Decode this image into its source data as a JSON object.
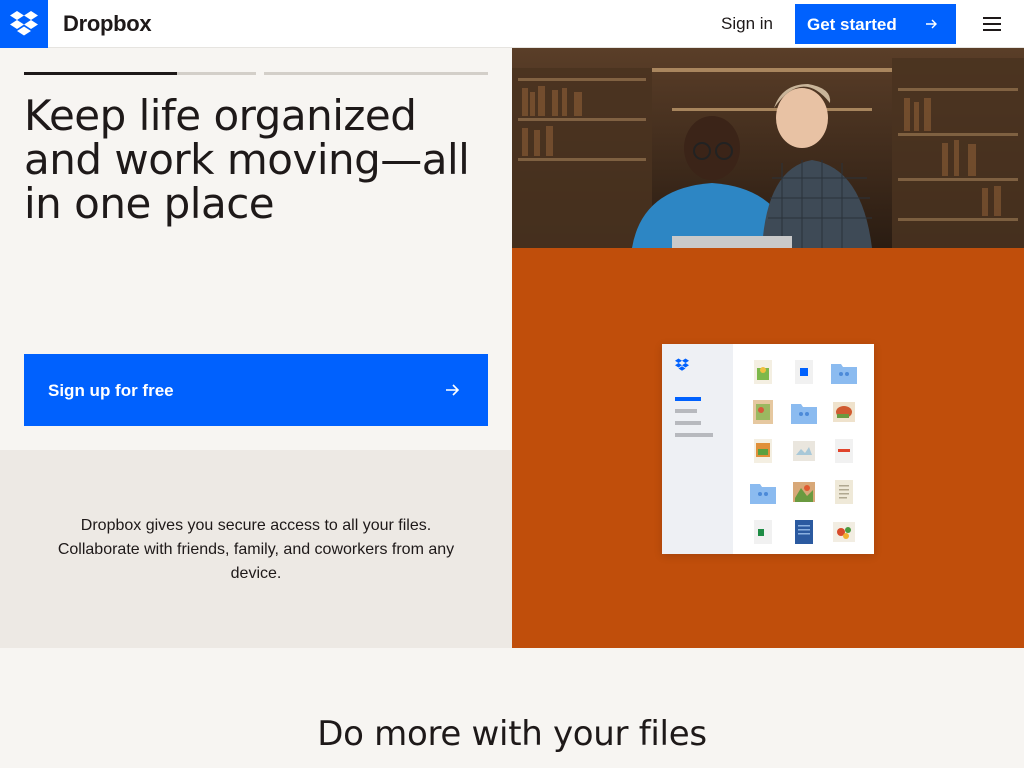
{
  "header": {
    "brand": "Dropbox",
    "sign_in": "Sign in",
    "get_started": "Get started",
    "logo_icon": "dropbox-logo-icon",
    "menu_icon": "hamburger-menu-icon",
    "arrow_icon": "arrow-right-icon"
  },
  "hero": {
    "headline": "Keep life organized and work moving—all in one place",
    "signup_label": "Sign up for free",
    "description": "Dropbox gives you secure access to all your files. Collaborate with friends, family, and coworkers from any device.",
    "carousel": {
      "slides": 3,
      "active_slide": 1,
      "active_progress": 0.6
    }
  },
  "colors": {
    "brand_blue": "#0061fe",
    "accent_orange": "#c04e0b",
    "text": "#1e1919",
    "background": "#f7f5f2",
    "panel": "#ede9e4"
  },
  "section": {
    "title": "Do more with your files"
  }
}
